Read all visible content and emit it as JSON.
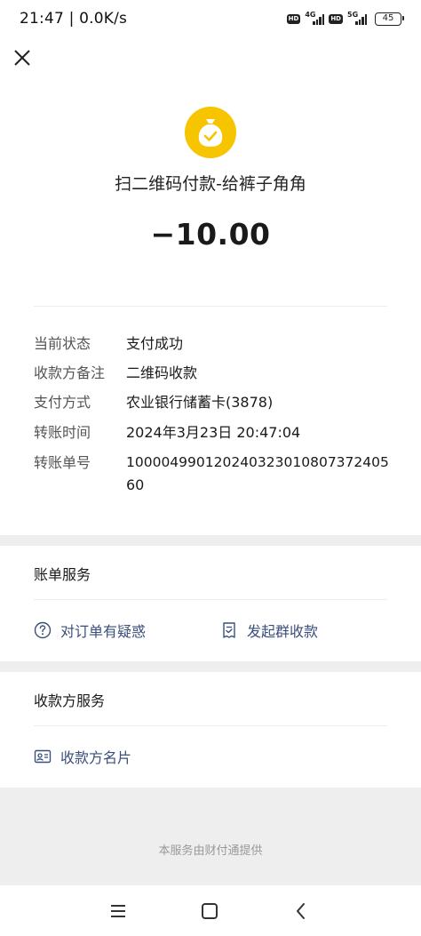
{
  "status_bar": {
    "time_speed": "21:47 | 0.0K/s",
    "hd_1": "HD",
    "net_1": "4G",
    "hd_2": "HD",
    "net_2": "5G",
    "battery": "45"
  },
  "summary": {
    "icon": "money-bag-check-icon",
    "title": "扫二维码付款-给裤子角角",
    "amount": "−10.00",
    "accent_color": "#f7c400"
  },
  "details": [
    {
      "key": "当前状态",
      "value": "支付成功"
    },
    {
      "key": "收款方备注",
      "value": "二维码收款"
    },
    {
      "key": "支付方式",
      "value": "农业银行储蓄卡(3878)"
    },
    {
      "key": "转账时间",
      "value": "2024年3月23日 20:47:04"
    },
    {
      "key": "转账单号",
      "value": "100004990120240323010807372405",
      "value_line2": "60"
    }
  ],
  "bill_service": {
    "title": "账单服务",
    "question_label": "对订单有疑惑",
    "group_collect_label": "发起群收款",
    "link_color": "#3a4f7a"
  },
  "payee_service": {
    "title": "收款方服务",
    "card_label": "收款方名片"
  },
  "footer": {
    "text": "本服务由财付通提供"
  }
}
